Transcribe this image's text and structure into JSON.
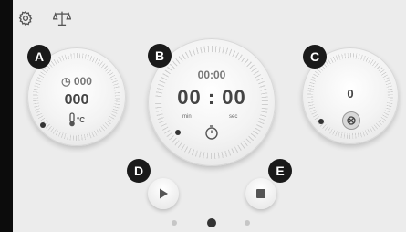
{
  "labels": {
    "a": "A",
    "b": "B",
    "c": "C",
    "d": "D",
    "e": "E"
  },
  "dial_a": {
    "top_value": "000",
    "main_value": "000",
    "unit": "°C"
  },
  "dial_b": {
    "sub_time": "00:00",
    "main_time": "00 : 00",
    "min_label": "min",
    "sec_label": "sec"
  },
  "dial_c": {
    "value": "0"
  },
  "pagination": {
    "total": 3,
    "active_index": 1
  },
  "colors": {
    "background": "#ececec",
    "label_bg": "#1a1a1a",
    "text": "#444444"
  }
}
